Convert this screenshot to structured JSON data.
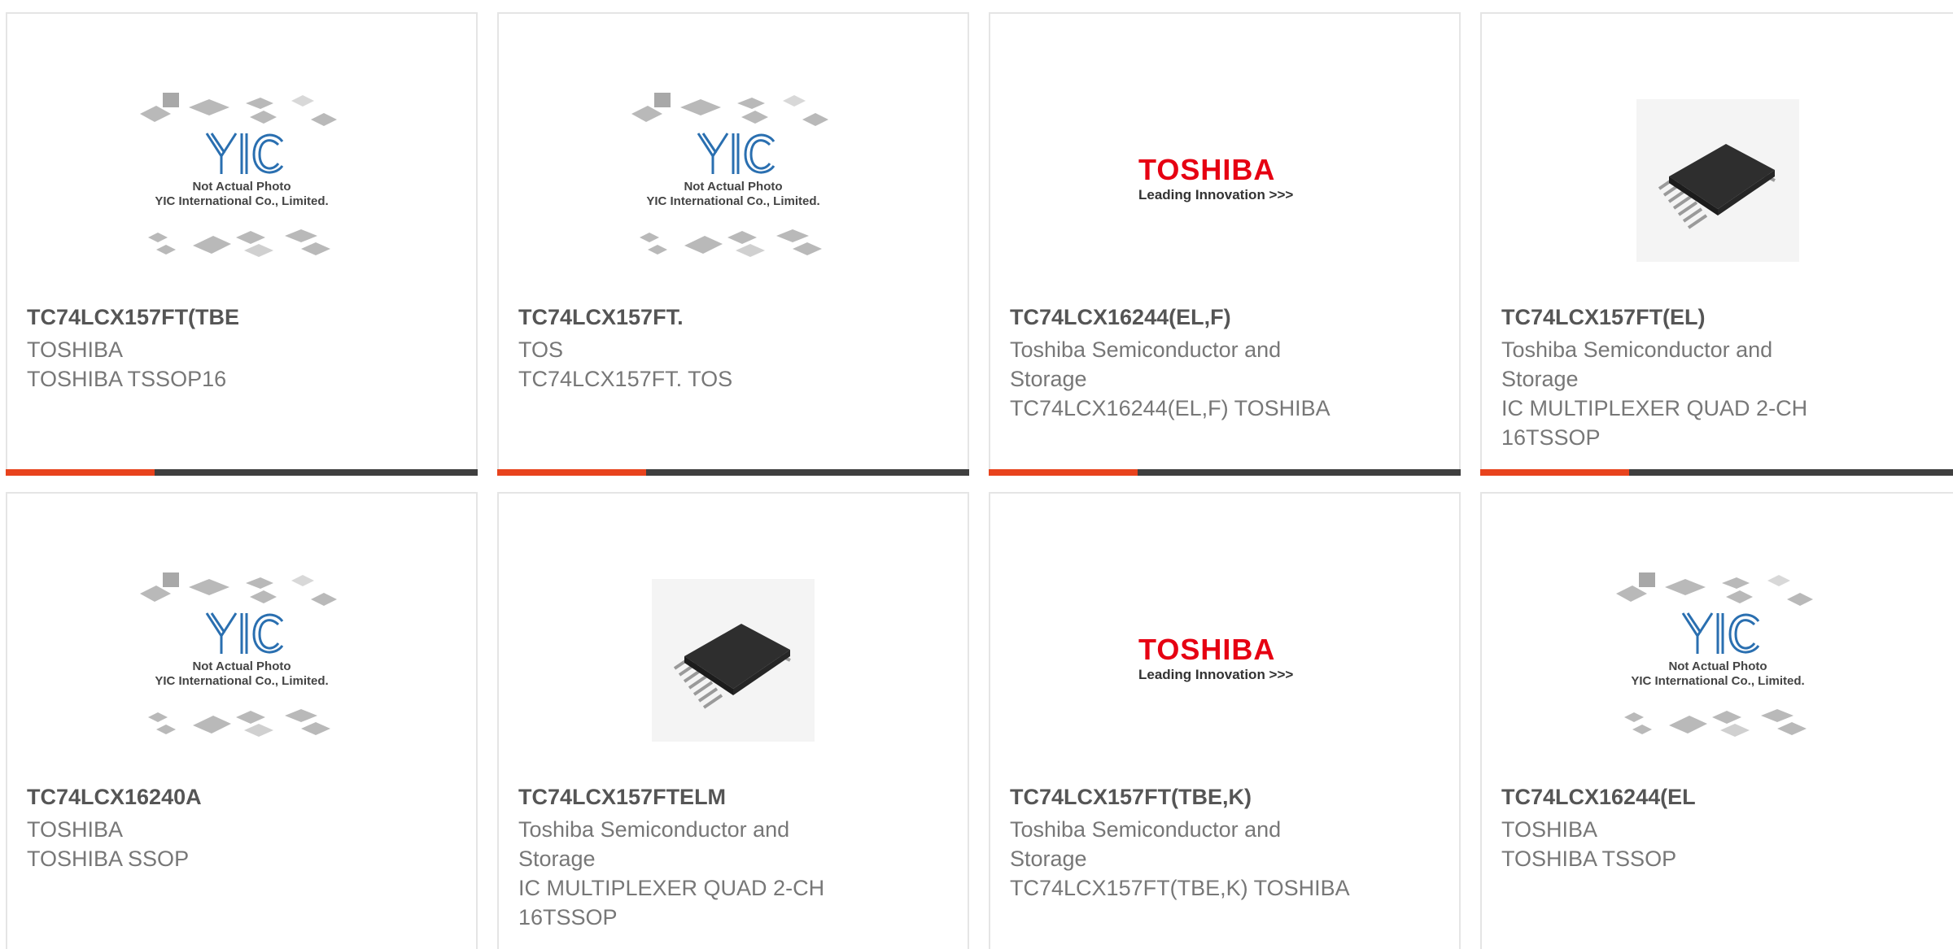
{
  "colors": {
    "accent": "#e8431d",
    "bar": "#3f3f3f",
    "toshiba_red": "#e60012"
  },
  "image_captions": {
    "yic_line1": "Not Actual Photo",
    "yic_line2": "YIC International Co., Limited.",
    "toshiba_logo": "TOSHIBA",
    "toshiba_tagline": "Leading Innovation >>>"
  },
  "products": [
    {
      "title": "TC74LCX157FT(TBE",
      "brand": "TOSHIBA",
      "desc": "TOSHIBA TSSOP16",
      "image": "yic-placeholder"
    },
    {
      "title": "TC74LCX157FT.",
      "brand": "TOS",
      "desc": "TC74LCX157FT. TOS",
      "image": "yic-placeholder"
    },
    {
      "title": "TC74LCX16244(EL,F)",
      "brand": "Toshiba Semiconductor and Storage",
      "desc": "TC74LCX16244(EL,F) TOSHIBA",
      "image": "toshiba-logo"
    },
    {
      "title": "TC74LCX157FT(EL)",
      "brand": "Toshiba Semiconductor and Storage",
      "desc": "IC MULTIPLEXER QUAD 2-CH 16TSSOP",
      "image": "chip-photo"
    },
    {
      "title": "TC74LCX16240A",
      "brand": "TOSHIBA",
      "desc": "TOSHIBA SSOP",
      "image": "yic-placeholder"
    },
    {
      "title": "TC74LCX157FTELM",
      "brand": "Toshiba Semiconductor and Storage",
      "desc": "IC MULTIPLEXER QUAD 2-CH 16TSSOP",
      "image": "chip-photo"
    },
    {
      "title": "TC74LCX157FT(TBE,K)",
      "brand": "Toshiba Semiconductor and Storage",
      "desc": "TC74LCX157FT(TBE,K) TOSHIBA",
      "image": "toshiba-logo"
    },
    {
      "title": "TC74LCX16244(EL",
      "brand": "TOSHIBA",
      "desc": "TOSHIBA TSSOP",
      "image": "yic-placeholder"
    }
  ]
}
